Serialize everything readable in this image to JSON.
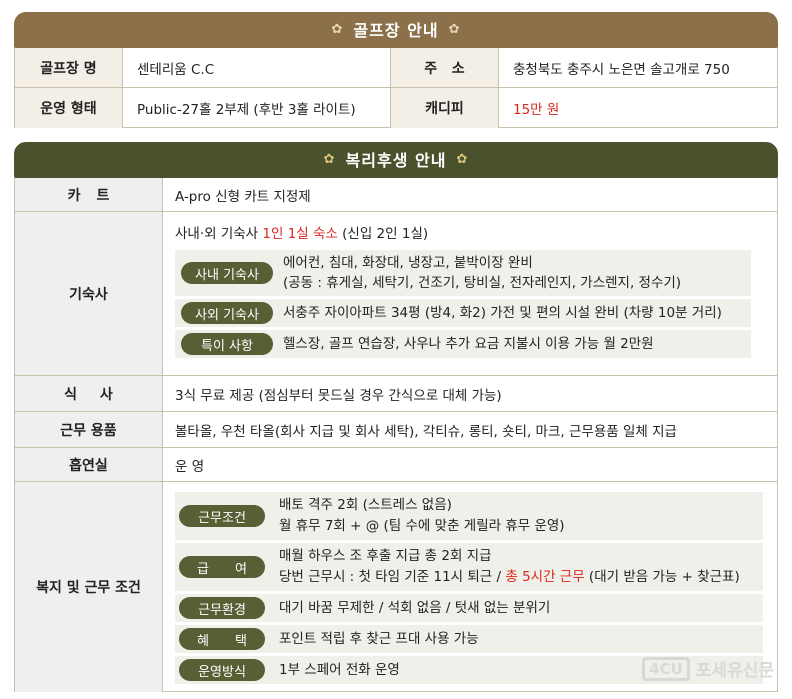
{
  "golf": {
    "banner": "골프장 안내",
    "rows": [
      {
        "label1": "골프장 명",
        "value1": "센테리움 C.C",
        "label2": "주   소",
        "value2": "충청북도 충주시 노은면 솔고개로 750"
      },
      {
        "label1": "운영 형태",
        "value1": "Public-27홀 2부제 (후반 3홀 라이트)",
        "label2": "캐디피",
        "value2": "15만 원"
      }
    ]
  },
  "welfare": {
    "banner": "복리후생 안내",
    "cart": {
      "label": "카트",
      "value": "A-pro 신형 카트 지정제"
    },
    "dorm": {
      "label": "기숙사",
      "head_a": "사내‧외 기숙사 ",
      "head_red": "1인 1실 숙소",
      "head_b": " (신입 2인 1실)",
      "items": [
        {
          "tag": "사내 기숙사",
          "line1": "에어컨, 침대, 화장대, 냉장고, 붙박이장 완비",
          "line2": "(공동 : 휴게실, 세탁기, 건조기, 탕비실, 전자레인지, 가스렌지, 정수기)"
        },
        {
          "tag": "사외 기숙사",
          "line1": "서충주 자이아파트 34평 (방4, 화2) 가전 및 편의 시설 완비 (차량 10분 거리)",
          "line2": ""
        },
        {
          "tag": "특이 사항",
          "line1": "헬스장, 골프 연습장, 사우나 추가 요금  지불시 이용 가능 월 2만원",
          "line2": ""
        }
      ]
    },
    "meal": {
      "label": "식 사",
      "value": "3식 무료 제공 (점심부터 못드실 경우 간식으로 대체 가능)"
    },
    "gear": {
      "label": "근무 용품",
      "value": "볼타올, 우천 타올(회사 지급 및 회사 세탁), 각티슈, 롱티, 숏티, 마크, 근무용품 일체 지급"
    },
    "smoke": {
      "label": "흡연실",
      "value": "운 영"
    },
    "conditions": {
      "label": "복지 및 근무 조건",
      "items": [
        {
          "tag": "근무조건",
          "line1": "배토 격주 2회 (스트레스 없음)",
          "line2": "월 휴무 7회 + @ (팀 수에 맞춘 게릴라 휴무 운영)"
        },
        {
          "tag": "급 여",
          "line1": "매월 하우스 조 후출 지급 총 2회 지급",
          "line2a": "당번 근무시 : 첫 타임 기준 11시 퇴근 / ",
          "line2red": "총 5시간 근무",
          "line2b": " (대기 받음 가능 + 찾근표)"
        },
        {
          "tag": "근무환경",
          "line1": "대기 바꿈 무제한 / 석회 없음 / 텃새 없는 분위기"
        },
        {
          "tag": "혜 택",
          "line1": "포인트 적립 후 찾근 프대 사용 가능"
        },
        {
          "tag": "운영방식",
          "line1": "1부 스페어 전화 운영"
        }
      ]
    }
  },
  "ornament": "✿",
  "watermark": {
    "logo": "4CU",
    "text": "포세유신문"
  },
  "colors": {
    "golf_banner": "#8b7049",
    "welfare_banner": "#49512d",
    "pill": "#575f34",
    "accent_red": "#d8281f"
  }
}
